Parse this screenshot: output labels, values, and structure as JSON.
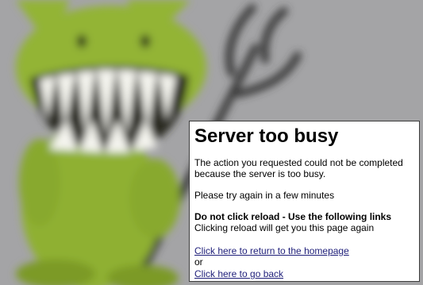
{
  "colors": {
    "background": "#a4a4a6",
    "mascot": "#93b436",
    "panel_background": "#ffffff",
    "link": "#1f1f7a"
  },
  "icons": {
    "mascot": "demon-mascot-with-trident"
  },
  "dialog": {
    "title": "Server too busy",
    "message_line1": "The action you requested could not be completed",
    "message_line2": "because the server is too busy.",
    "retry_text": "Please try again in a few minutes",
    "warning_bold": "Do not click reload - Use the following links",
    "warning_detail": "Clicking reload will get you this page again",
    "homepage_link": "Click here to return to the homepage",
    "or_text": "or",
    "back_link": "Click here to go back"
  }
}
